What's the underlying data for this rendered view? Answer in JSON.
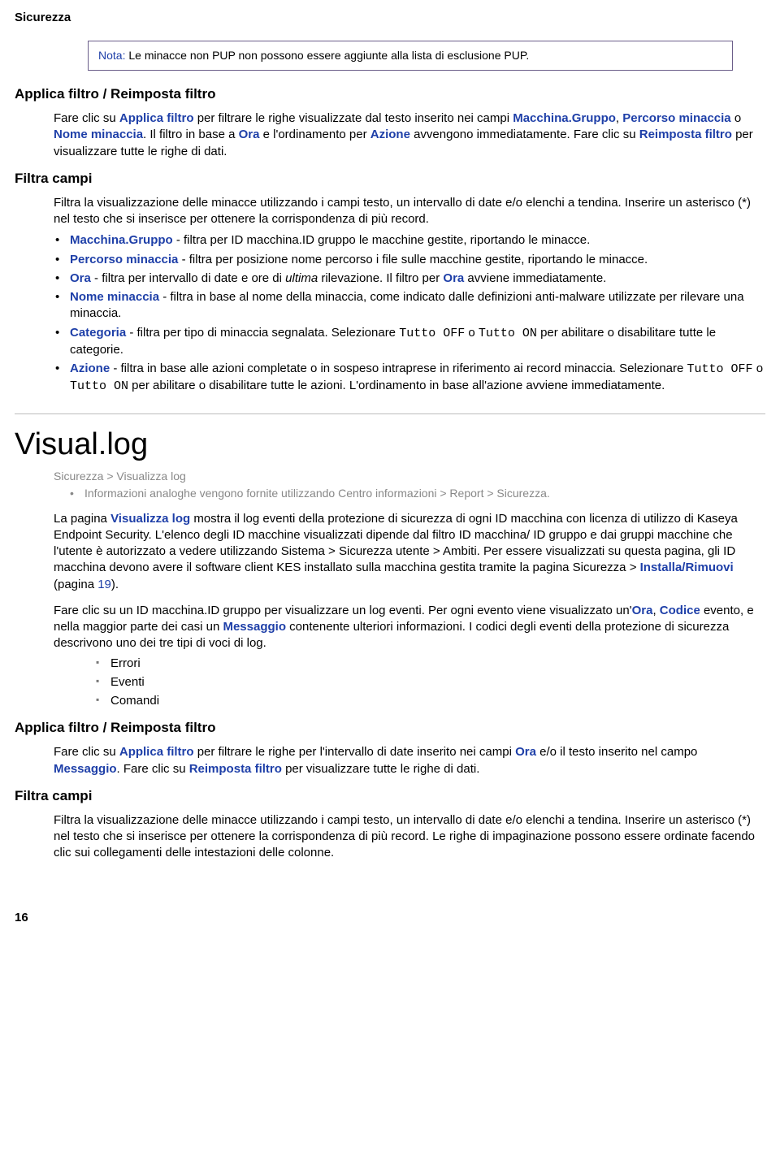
{
  "header": "Sicurezza",
  "note": {
    "label": "Nota:",
    "text": " Le minacce non PUP non possono essere aggiunte alla lista di esclusione PUP."
  },
  "s1": {
    "title": "Applica filtro / Reimposta filtro",
    "p1a": "Fare clic su ",
    "p1b": "Applica filtro",
    "p1c": " per filtrare le righe visualizzate dal testo inserito nei campi ",
    "p1d": "Macchina.Gruppo",
    "p1e": ", ",
    "p1f": "Percorso minaccia",
    "p1g": " o ",
    "p1h": "Nome minaccia",
    "p1i": ". Il filtro in base a ",
    "p1j": "Ora",
    "p1k": " e l'ordinamento per ",
    "p1l": "Azione",
    "p1m": " avvengono immediatamente. Fare clic su ",
    "p1n": "Reimposta filtro",
    "p1o": " per visualizzare tutte le righe di dati."
  },
  "s2": {
    "title": "Filtra campi",
    "p1": "Filtra la visualizzazione delle minacce utilizzando i campi testo, un intervallo di date e/o elenchi a tendina. Inserire un asterisco (*) nel testo che si inserisce per ottenere la corrispondenza di più record.",
    "items": [
      {
        "b": "Macchina.Gruppo",
        "t": " - filtra per ID macchina.ID gruppo le macchine gestite, riportando le minacce."
      },
      {
        "b": "Percorso minaccia",
        "t": " - filtra per posizione nome percorso i file sulle macchine gestite, riportando le minacce."
      },
      {
        "b": "Ora",
        "t": " - filtra per intervallo di date e ore di ",
        "i": "ultima",
        "t2": " rilevazione. Il filtro per ",
        "b2": "Ora",
        "t3": " avviene immediatamente."
      },
      {
        "b": "Nome minaccia",
        "t": " - filtra in base al nome della minaccia, come indicato dalle definizioni anti-malware utilizzate per rilevare una minaccia."
      },
      {
        "b": "Categoria",
        "t": " - filtra per tipo di minaccia segnalata. Selezionare ",
        "m1": "Tutto OFF",
        "t2": " o ",
        "m2": "Tutto ON",
        "t3": " per abilitare o disabilitare tutte le categorie."
      },
      {
        "b": "Azione",
        "t": " - filtra in base alle azioni completate o in sospeso intraprese in riferimento ai record minaccia. Selezionare ",
        "m1": "Tutto OFF",
        "t2": " o ",
        "m2": "Tutto ON",
        "t3": " per abilitare o disabilitare tutte le azioni. L'ordinamento in base all'azione avviene immediatamente."
      }
    ]
  },
  "visual": {
    "title": "Visual.log",
    "breadcrumb": "Sicurezza > Visualizza log",
    "sub": "Informazioni analoghe vengono fornite utilizzando Centro informazioni > Report > Sicurezza.",
    "p1a": "La pagina ",
    "p1b": "Visualizza log",
    "p1c": " mostra il log eventi della protezione di sicurezza di ogni ID macchina con licenza di utilizzo di Kaseya Endpoint Security. L'elenco degli ID macchine visualizzati dipende dal filtro ID macchina/ ID gruppo e dai gruppi macchine che l'utente è autorizzato a vedere utilizzando Sistema > Sicurezza utente > Ambiti. Per essere visualizzati su questa pagina, gli ID macchina devono avere il software client KES installato sulla macchina gestita tramite la pagina Sicurezza > ",
    "p1d": "Installa/Rimuovi",
    "p1e": " (pagina ",
    "p1f": "19",
    "p1g": ").",
    "p2a": "Fare clic su un ID macchina.ID gruppo per visualizzare un log eventi. Per ogni evento viene visualizzato un'",
    "p2b": "Ora",
    "p2c": ", ",
    "p2d": "Codice",
    "p2e": " evento, e nella maggior parte dei casi un ",
    "p2f": "Messaggio",
    "p2g": " contenente ulteriori informazioni. I codici degli eventi della protezione di sicurezza descrivono uno dei tre tipi di voci di log.",
    "logs": [
      "Errori",
      "Eventi",
      "Comandi"
    ]
  },
  "s3": {
    "title": "Applica filtro / Reimposta filtro",
    "p1a": "Fare clic su ",
    "p1b": "Applica filtro",
    "p1c": " per filtrare le righe per l'intervallo di date inserito nei campi ",
    "p1d": "Ora",
    "p1e": " e/o il testo inserito nel campo ",
    "p1f": "Messaggio",
    "p1g": ". Fare clic su ",
    "p1h": "Reimposta filtro",
    "p1i": " per visualizzare tutte le righe di dati."
  },
  "s4": {
    "title": "Filtra campi",
    "p1": "Filtra la visualizzazione delle minacce utilizzando i campi testo, un intervallo di date e/o elenchi a tendina. Inserire un asterisco (*) nel testo che si inserisce per ottenere la corrispondenza di più record. Le righe di impaginazione possono essere ordinate facendo clic sui collegamenti delle intestazioni delle colonne."
  },
  "pagenum": "16"
}
